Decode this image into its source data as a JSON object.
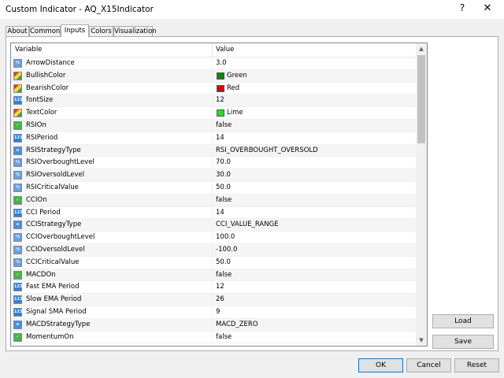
{
  "window": {
    "title": "Custom Indicator - AQ_X15Indicator",
    "help_icon": "?",
    "close_icon": "✕"
  },
  "tabs": [
    "About",
    "Common",
    "Inputs",
    "Colors",
    "Visualization"
  ],
  "active_tab": "Inputs",
  "grid": {
    "col_variable": "Variable",
    "col_value": "Value",
    "rows": [
      {
        "icon": "double-param-icon",
        "name": "ArrowDistance",
        "value": "3.0"
      },
      {
        "icon": "color-param-icon",
        "name": "BullishColor",
        "value": "Green",
        "swatch": "#0a8a0a"
      },
      {
        "icon": "color-param-icon",
        "name": "BearishColor",
        "value": "Red",
        "swatch": "#e00000"
      },
      {
        "icon": "int-param-icon",
        "name": "fontSize",
        "value": "12"
      },
      {
        "icon": "color-param-icon",
        "name": "TextColor",
        "value": "Lime",
        "swatch": "#22e01a"
      },
      {
        "icon": "bool-param-icon",
        "name": "RSIOn",
        "value": "false"
      },
      {
        "icon": "int-param-icon",
        "name": "RSIPeriod",
        "value": "14"
      },
      {
        "icon": "enum-param-icon",
        "name": "RSIStrategyType",
        "value": "RSI_OVERBOUGHT_OVERSOLD"
      },
      {
        "icon": "double-param-icon",
        "name": "RSIOverboughtLevel",
        "value": "70.0"
      },
      {
        "icon": "double-param-icon",
        "name": "RSIOversoldLevel",
        "value": "30.0"
      },
      {
        "icon": "double-param-icon",
        "name": "RSICriticalValue",
        "value": "50.0"
      },
      {
        "icon": "bool-param-icon",
        "name": "CCIOn",
        "value": "false"
      },
      {
        "icon": "int-param-icon",
        "name": "CCI Period",
        "value": "14"
      },
      {
        "icon": "enum-param-icon",
        "name": "CCIStrategyType",
        "value": "CCI_VALUE_RANGE"
      },
      {
        "icon": "double-param-icon",
        "name": "CCIOverboughtLevel",
        "value": "100.0"
      },
      {
        "icon": "double-param-icon",
        "name": "CCIOversoldLevel",
        "value": "-100.0"
      },
      {
        "icon": "double-param-icon",
        "name": "CCICriticalValue",
        "value": "50.0"
      },
      {
        "icon": "bool-param-icon",
        "name": "MACDOn",
        "value": "false"
      },
      {
        "icon": "int-param-icon",
        "name": "Fast EMA Period",
        "value": "12"
      },
      {
        "icon": "int-param-icon",
        "name": "Slow EMA Period",
        "value": "26"
      },
      {
        "icon": "int-param-icon",
        "name": "Signal SMA Period",
        "value": "9"
      },
      {
        "icon": "enum-param-icon",
        "name": "MACDStrategyType",
        "value": "MACD_ZERO"
      },
      {
        "icon": "bool-param-icon",
        "name": "MomentumOn",
        "value": "false"
      }
    ]
  },
  "side_buttons": {
    "load": "Load",
    "save": "Save"
  },
  "bottom_buttons": {
    "ok": "OK",
    "cancel": "Cancel",
    "reset": "Reset"
  },
  "colors": {
    "accent": "#0078d7",
    "panel_bg": "#ffffff",
    "window_bg": "#f0f0f0"
  }
}
